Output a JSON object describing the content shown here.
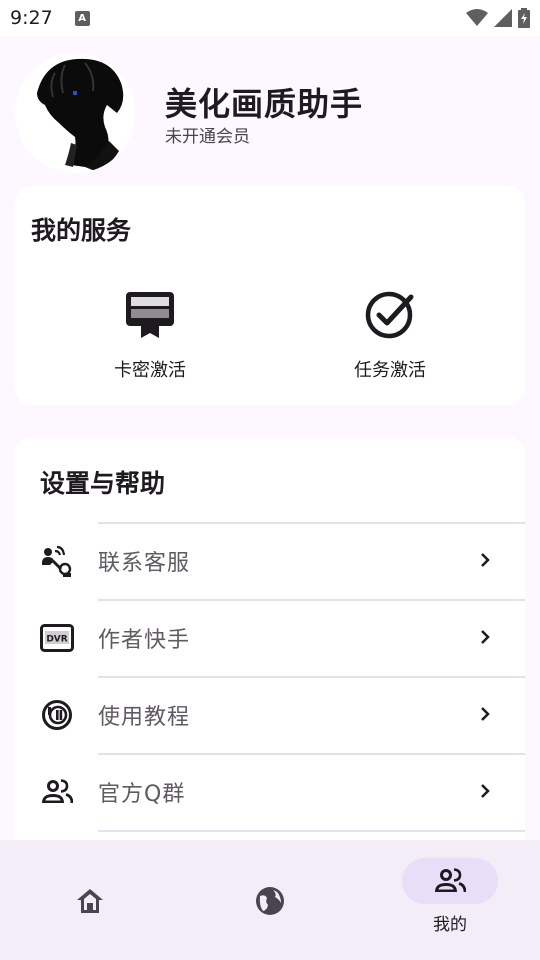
{
  "status_bar": {
    "time": "9:27",
    "indicator": "A",
    "icons": [
      "wifi-icon",
      "signal-icon",
      "battery-icon"
    ]
  },
  "profile": {
    "app_name": "美化画质助手",
    "member_status": "未开通会员"
  },
  "services": {
    "title": "我的服务",
    "items": [
      {
        "label": "卡密激活",
        "icon": "card-key-icon"
      },
      {
        "label": "任务激活",
        "icon": "check-circle-icon"
      }
    ]
  },
  "settings": {
    "title": "设置与帮助",
    "items": [
      {
        "label": "联系客服",
        "icon": "contact-support-icon"
      },
      {
        "label": "作者快手",
        "icon": "dvr-icon"
      },
      {
        "label": "使用教程",
        "icon": "tutorial-icon"
      },
      {
        "label": "官方Q群",
        "icon": "group-icon"
      }
    ]
  },
  "bottom_nav": {
    "items": [
      {
        "label": "",
        "icon": "home-icon"
      },
      {
        "label": "",
        "icon": "globe-icon"
      },
      {
        "label": "我的",
        "icon": "people-icon",
        "active": true
      }
    ]
  },
  "colors": {
    "background": "#fdf7ff",
    "card": "#ffffff",
    "nav_background": "#f3edf7",
    "active_pill": "#e8def8",
    "divider": "#e7e0ec"
  }
}
